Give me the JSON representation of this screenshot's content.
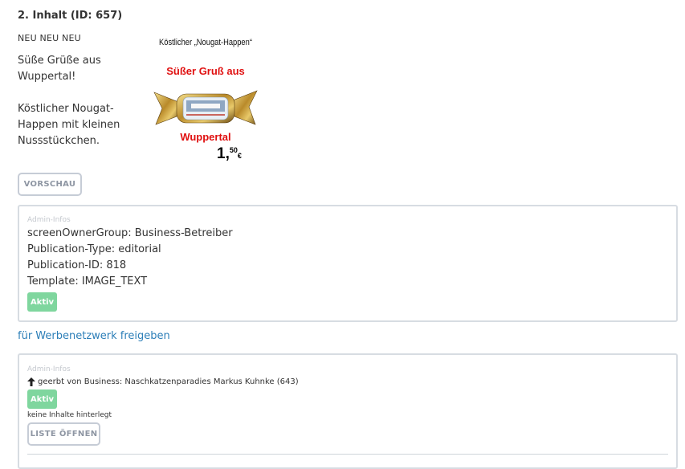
{
  "section": {
    "title": "2. Inhalt (ID: 657)",
    "badge": "NEU NEU NEU",
    "text_line1": "Süße Grüße aus Wuppertal!",
    "text_line2": "Köstlicher Nougat-Happen mit kleinen Nussstückchen."
  },
  "image": {
    "top_text": "Köstlicher „Nougat-Happen“",
    "red_text1": "Süßer Gruß aus",
    "red_text2": "Wuppertal",
    "price_main": "1,",
    "price_cents": "50",
    "price_currency": "€"
  },
  "buttons": {
    "preview": "VORSCHAU",
    "open_list": "LISTE ÖFFNEN"
  },
  "admin_panel": {
    "caption": "Admin-Infos",
    "owner_group": "screenOwnerGroup: Business-Betreiber",
    "publication_type": "Publication-Type: editorial",
    "publication_id": "Publication-ID: 818",
    "template": "Template: IMAGE_TEXT",
    "status": "Aktiv"
  },
  "share_link": "für Werbenetzwerk freigeben",
  "admin_panel2": {
    "caption": "Admin-Infos",
    "inherited": "geerbt von Business: Naschkatzenparadies Markus Kuhnke (643)",
    "status": "Aktiv",
    "note": "keine Inhalte hinterlegt"
  },
  "colors": {
    "status_active": "#7fd69e",
    "link": "#2d7fb8",
    "image_red": "#e01010",
    "border": "#d7dce2"
  }
}
